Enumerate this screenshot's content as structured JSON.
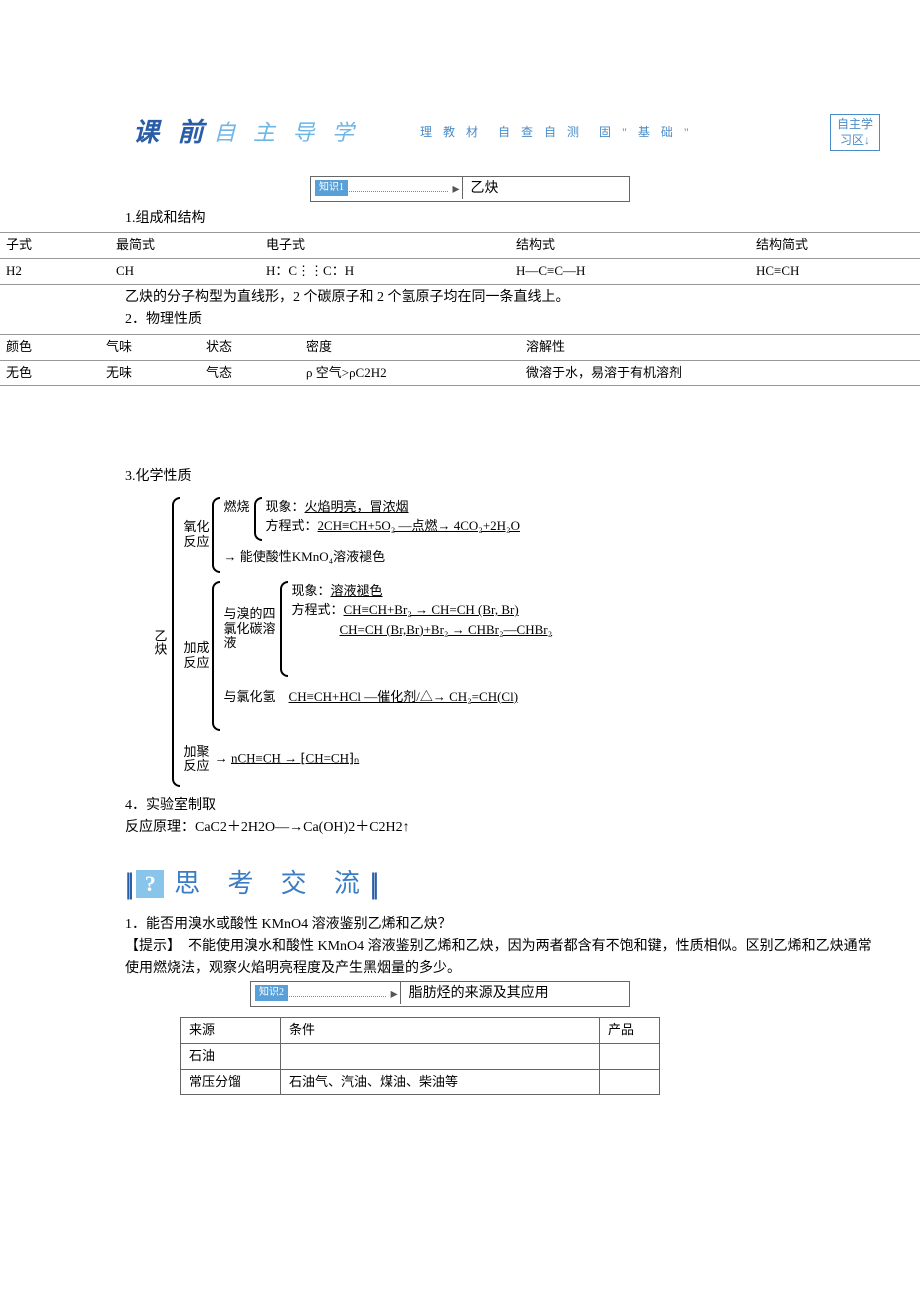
{
  "header": {
    "title_main": "课 前",
    "title_sub": "自 主 导 学",
    "hint": "理 教 材　自 查 自 测　固 \" 基 础 \"",
    "right_box_line1": "自主学",
    "right_box_line2": "习区↓"
  },
  "topic1": {
    "tag": "知识1",
    "label": "乙炔"
  },
  "s1": {
    "heading": "1.组成和结构"
  },
  "table1": {
    "h1": "子式",
    "h2": "最简式",
    "h3": "电子式",
    "h4": "结构式",
    "h5": "结构简式",
    "r1": "H2",
    "r2": "CH",
    "r3": "H：C⋮⋮C：H",
    "r4": "H—C≡C—H",
    "r5": "HC≡CH"
  },
  "note1": "乙炔的分子构型为直线形，2 个碳原子和 2 个氢原子均在同一条直线上。",
  "s2": {
    "heading": "2．物理性质"
  },
  "table2": {
    "h1": "颜色",
    "h2": "气味",
    "h3": "状态",
    "h4": "密度",
    "h5": "溶解性",
    "r1": "无色",
    "r2": "无味",
    "r3": "气态",
    "r4": "ρ 空气>ρC2H2",
    "r5": "微溶于水，易溶于有机溶剂"
  },
  "s3": {
    "heading": "3.化学性质"
  },
  "diagram": {
    "root": "乙炔",
    "ox_label": "氧化反应",
    "ox_burn": "燃烧",
    "ox_burn_phen_label": "现象：",
    "ox_burn_phen": "火焰明亮，冒浓烟",
    "ox_burn_eq_label": "方程式：",
    "ox_burn_eq": "2CH≡CH+5O₂ —点燃→ 4CO₂+2H₂O",
    "ox_kmno4": "能使酸性KMnO₄溶液褪色",
    "add_label": "加成反应",
    "add_br_label": "与溴的四氯化碳溶液",
    "add_br_phen_label": "现象：",
    "add_br_phen": "溶液褪色",
    "add_br_eq_label": "方程式：",
    "add_br_eq1": "CH≡CH+Br₂ → CH=CH (Br, Br)",
    "add_br_eq2": "CH=CH (Br,Br)+Br₂ → CHBr₂—CHBr₂",
    "add_hcl_label": "与氯化氢",
    "add_hcl_eq": "CH≡CH+HCl —催化剂/△→ CH₂=CH(Cl)",
    "poly_label": "加聚反应",
    "poly_eq": "nCH≡CH → ⁅CH=CH⁆ₙ"
  },
  "s4": {
    "heading": "4．实验室制取",
    "line": "反应原理：CaC2＋2H2O―→Ca(OH)2＋C2H2↑"
  },
  "think": {
    "title": "思 考 交 流"
  },
  "q1": {
    "q": "1．能否用溴水或酸性 KMnO4 溶液鉴别乙烯和乙炔？",
    "a_label": "【提示】",
    "a": "不能使用溴水和酸性 KMnO4 溶液鉴别乙烯和乙炔，因为两者都含有不饱和键，性质相似。区别乙烯和乙炔通常使用燃烧法，观察火焰明亮程度及产生黑烟量的多少。"
  },
  "topic2": {
    "tag": "知识2",
    "label": "脂肪烃的来源及其应用"
  },
  "table3": {
    "h1": "来源",
    "h2": "条件",
    "h3": "产品",
    "r1c1": "石油",
    "r1c2": "",
    "r1c3": "",
    "r2c1": "常压分馏",
    "r2c2": "石油气、汽油、煤油、柴油等",
    "r2c3": ""
  }
}
